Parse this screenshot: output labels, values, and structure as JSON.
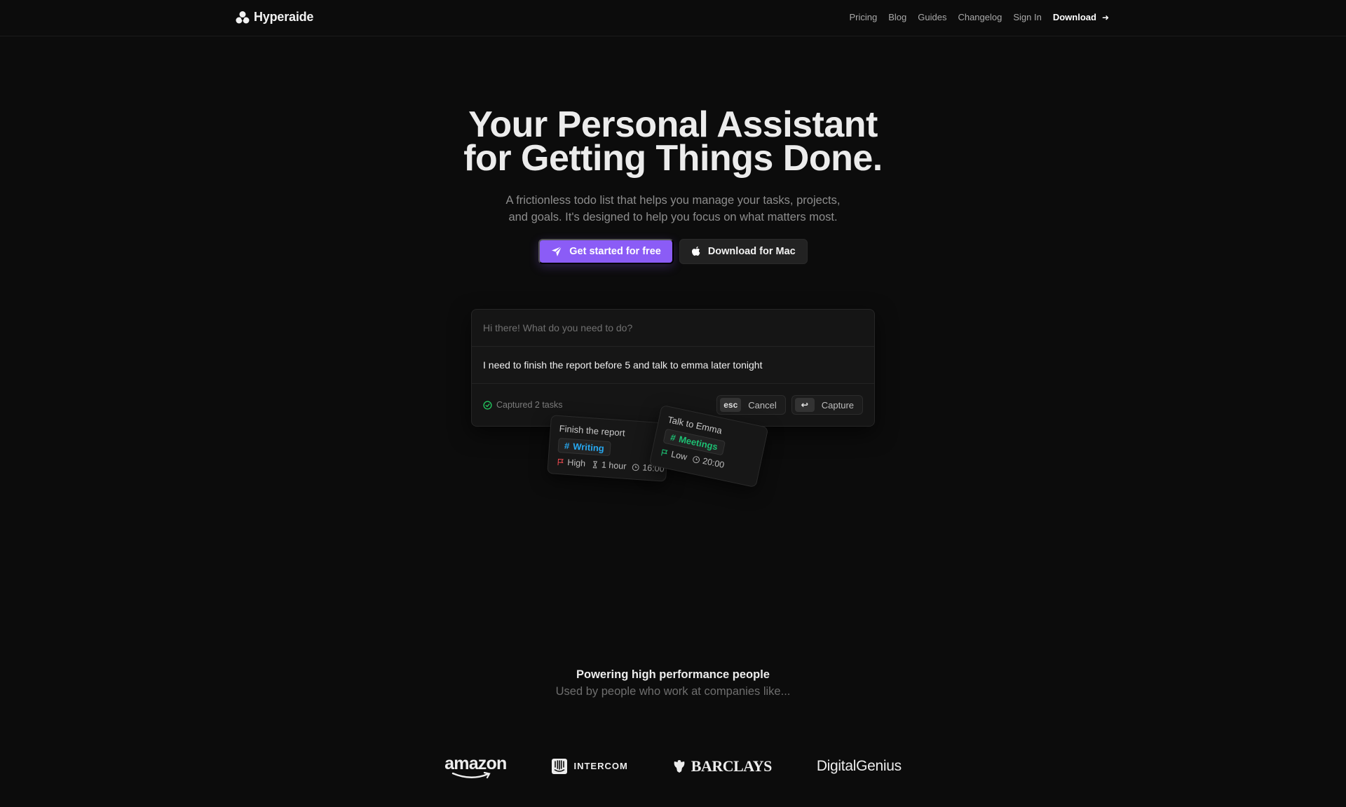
{
  "brand": {
    "name": "Hyperaide",
    "logo_icon": "triangle-circles-logo"
  },
  "nav": {
    "links": [
      "Pricing",
      "Blog",
      "Guides",
      "Changelog",
      "Sign In"
    ],
    "download": {
      "label": "Download",
      "icon": "arrow-right-icon"
    }
  },
  "hero": {
    "title_line1": "Your Personal Assistant",
    "title_line2": "for Getting Things Done.",
    "subtitle_line1": "A frictionless todo list that helps you manage your tasks, projects,",
    "subtitle_line2": "and goals. It's designed to help you focus on what matters most.",
    "primary_cta": {
      "label": "Get started for free",
      "icon": "send-icon"
    },
    "secondary_cta": {
      "label": "Download for Mac",
      "icon": "apple-icon"
    }
  },
  "capture": {
    "prompt": "Hi there! What do you need to do?",
    "input_value": "I need to finish the report before 5 and talk to emma later tonight",
    "status": "Captured 2 tasks",
    "cancel": {
      "key": "esc",
      "label": "Cancel"
    },
    "submit": {
      "key": "↩",
      "label": "Capture"
    }
  },
  "tasks": [
    {
      "title": "Finish the report",
      "tag": "Writing",
      "tag_color": "#27a8f0",
      "priority": "High",
      "priority_color": "#e5484d",
      "duration": "1 hour",
      "time": "16:00"
    },
    {
      "title": "Talk to Emma",
      "tag": "Meetings",
      "tag_color": "#1dbf73",
      "priority": "Low",
      "priority_color": "#1dbf73",
      "time": "20:00"
    }
  ],
  "companies": {
    "title": "Powering high performance people",
    "subtitle": "Used by people who work at companies like...",
    "logos": [
      "amazon",
      "INTERCOM",
      "BARCLAYS",
      "DigitalGenius"
    ]
  },
  "colors": {
    "accent": "#8b5cf6",
    "background": "#0c0c0c",
    "success": "#22c55e"
  }
}
